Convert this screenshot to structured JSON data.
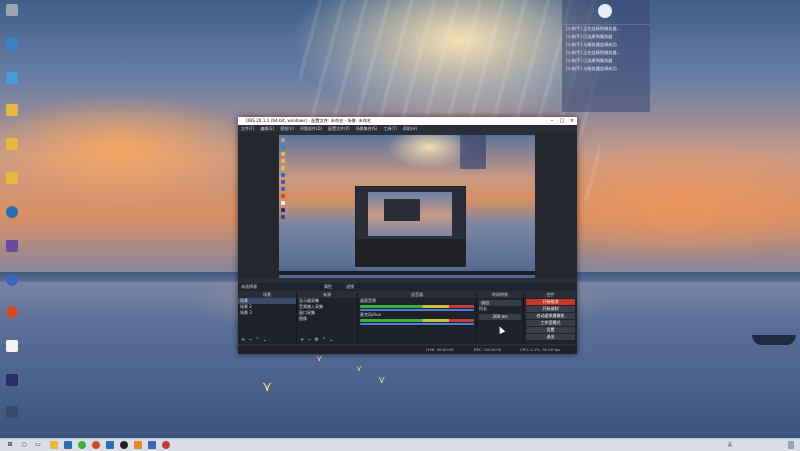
{
  "desktop": {
    "icons": [
      {
        "label": "",
        "color": "#9aa6b8"
      },
      {
        "label": "",
        "color": "#3b82c4"
      },
      {
        "label": "",
        "color": "#e8b940"
      },
      {
        "label": "",
        "color": "#e8b940"
      },
      {
        "label": "",
        "color": "#e8b940"
      },
      {
        "label": "",
        "color": "#2a6fb0"
      },
      {
        "label": "",
        "color": "#6b4aa0"
      },
      {
        "label": "",
        "color": "#3a66b8"
      },
      {
        "label": "",
        "color": "#d04a2a"
      },
      {
        "label": "",
        "color": "#f2f2f2"
      },
      {
        "label": "",
        "color": "#2a2f6b"
      },
      {
        "label": "",
        "color": "#3a4a6a"
      }
    ]
  },
  "overlay": {
    "stat_left": "",
    "stat_right": "",
    "lines": [
      "[小助手] 正在连接到服务器...",
      "[小助手] 已连接到服务器",
      "[小助手] 与服务器连接成功",
      "",
      "[小助手] 正在连接到服务器...",
      "[小助手] 已连接到服务器",
      "[小助手] 与服务器连接成功"
    ]
  },
  "obs": {
    "title": "OBS 26.1.1 (64-bit, windows) - 配置文件: 未命名 - 场景: 未命名",
    "menu": [
      "文件(F)",
      "编辑(E)",
      "视图(V)",
      "停靠部件(D)",
      "配置文件(P)",
      "场景集合(S)",
      "工具(T)",
      "帮助(H)"
    ],
    "scenebar": {
      "label": "未选择源",
      "props": "属性",
      "filters": "滤镜"
    },
    "docks": {
      "scenes": {
        "title": "场景",
        "items": [
          "场景",
          "场景 2",
          "场景 3"
        ]
      },
      "sources": {
        "title": "来源",
        "items": [
          "显示器采集",
          "音频输入采集",
          "窗口采集",
          "图像"
        ]
      },
      "mixer": {
        "title": "混音器",
        "items": [
          "桌面音频",
          "麦克风/Aux"
        ]
      },
      "transitions": {
        "title": "转场特效",
        "type": "淡出",
        "duration_label": "时长",
        "duration": "300 ms"
      },
      "controls": {
        "title": "控件",
        "buttons": [
          "开始推流",
          "开始录制",
          "启动虚拟摄像机",
          "工作室模式",
          "设置",
          "退出"
        ]
      }
    },
    "status": {
      "live": "LIVE: 00:00:00",
      "rec": "REC: 00:00:00",
      "cpu": "CPU: 2.1%, 30.00 fps"
    }
  },
  "taskbar": {
    "search_icon": "search-icon",
    "tray_lang": "英",
    "tray_time": "",
    "tray_date": ""
  }
}
